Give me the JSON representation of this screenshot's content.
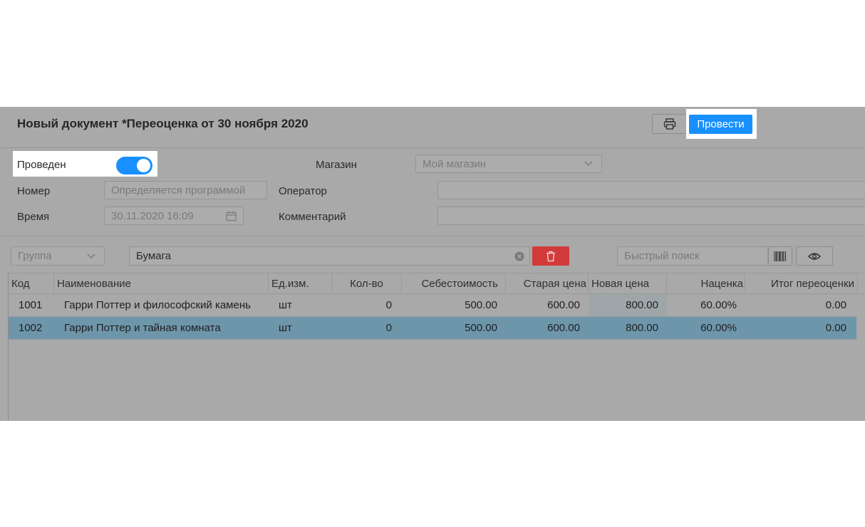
{
  "header": {
    "title": "Новый документ *Переоценка от 30 ноября 2020",
    "post_label": "Провести",
    "print_icon": "printer-icon"
  },
  "form": {
    "posted_label": "Проведен",
    "posted_value": true,
    "number_label": "Номер",
    "number_placeholder": "Определяется программой",
    "time_label": "Время",
    "time_value": "30.11.2020 16:09",
    "store_label": "Магазин",
    "store_value": "Мой магазин",
    "operator_label": "Оператор",
    "operator_value": "",
    "comment_label": "Комментарий",
    "comment_value": ""
  },
  "toolbar": {
    "group_placeholder": "Группа",
    "filter_value": "Бумага",
    "search_placeholder": "Быстрый поиск"
  },
  "table": {
    "columns": [
      "Код",
      "Наименование",
      "Ед.изм.",
      "Кол-во",
      "Себестоимость",
      "Старая цена",
      "Новая цена",
      "Наценка",
      "Итог переоценки"
    ],
    "rows": [
      {
        "code": "1001",
        "name": "Гарри Поттер и философский камень",
        "unit": "шт",
        "qty": "0",
        "cost": "500.00",
        "old_price": "600.00",
        "new_price": "800.00",
        "markup": "60.00%",
        "total": "0.00"
      },
      {
        "code": "1002",
        "name": "Гарри Поттер и тайная комната",
        "unit": "шт",
        "qty": "0",
        "cost": "500.00",
        "old_price": "600.00",
        "new_price": "800.00",
        "markup": "60.00%",
        "total": "0.00"
      }
    ],
    "selected_row": 1
  },
  "colors": {
    "primary": "#1890ff",
    "danger": "#d23a3a",
    "overlay": "#a9a9a9",
    "selected_row": "#6e96ab"
  }
}
